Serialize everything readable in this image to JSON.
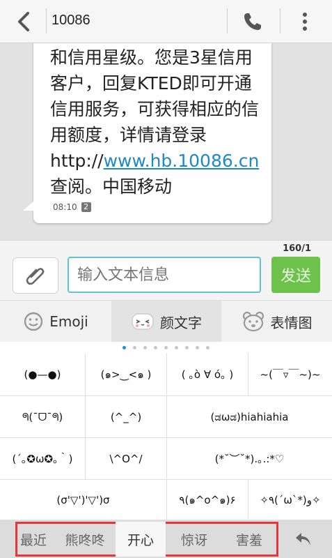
{
  "header": {
    "title": "10086",
    "back_icon": "back-arrow-icon",
    "phone_icon": "phone-icon",
    "menu_icon": "overflow-menu-icon"
  },
  "message": {
    "text_before": "和信用星级。您是3星信用客户，回复KTED即可开通信用服务，可获得相应的信用额度，详情请登录http://",
    "link": "www.hb.10086.cn",
    "text_after": "查阅。中国移动",
    "time": "08:10",
    "sim": "2"
  },
  "composer": {
    "counter": "160/1",
    "placeholder": "输入文本信息",
    "send_label": "发送",
    "attach_icon": "paperclip-icon"
  },
  "emoji_tabs": [
    {
      "label": "Emoji",
      "icon": "smiley-icon",
      "active": false
    },
    {
      "label": "颜文字",
      "icon": "kaomoji-face-icon",
      "active": true
    },
    {
      "label": "表情图",
      "icon": "bear-face-icon",
      "active": false
    }
  ],
  "pager": {
    "count": 9,
    "active": 0
  },
  "kaomoji": [
    [
      "(●—●)",
      "(๑>‿<๑ )",
      "( ｡ò ∀ ó｡ )",
      "~(￣▿￣~)~"
    ],
    [
      "ᖗ(¯ᗜ¯ᖗ)",
      "(^_^)",
      "(ಡωಡ)hiahiahia"
    ],
    [
      "(´｡✪ω✪｡｀)",
      "\\^O^/",
      "(*˘︶˘*).｡.:*♡"
    ],
    [
      "(σ'▽')'▽')σ",
      "٩(๑^o^๑)۶",
      "✧٩(ˊωˋ*)و✧"
    ]
  ],
  "categories": [
    {
      "label": "最近",
      "active": false
    },
    {
      "label": "熊咚咚",
      "active": false
    },
    {
      "label": "开心",
      "active": true
    },
    {
      "label": "惊讶",
      "active": false
    },
    {
      "label": "害羞",
      "active": false
    }
  ],
  "colors": {
    "accent": "#5ec3d5",
    "send": "#6cc24a",
    "link": "#1f88c6",
    "highlight_box": "#e8343b"
  }
}
